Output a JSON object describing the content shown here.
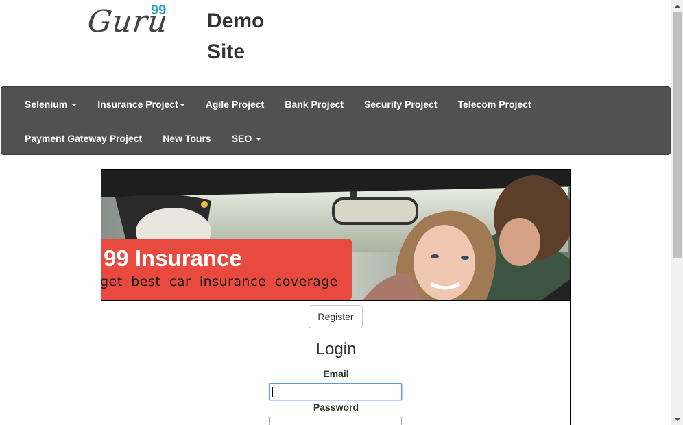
{
  "header": {
    "logo_text": "Guru",
    "logo_sup": "99",
    "site_title": "Demo Site"
  },
  "navbar": {
    "row1": [
      {
        "label": "Selenium",
        "dropdown": true
      },
      {
        "label": "Insurance Project",
        "dropdown": true
      },
      {
        "label": "Agile Project",
        "dropdown": false
      },
      {
        "label": "Bank Project",
        "dropdown": false
      },
      {
        "label": "Security Project",
        "dropdown": false
      },
      {
        "label": "Telecom Project",
        "dropdown": false
      }
    ],
    "row2": [
      {
        "label": "Payment Gateway Project",
        "dropdown": false
      },
      {
        "label": "New Tours",
        "dropdown": false
      },
      {
        "label": "SEO",
        "dropdown": true
      }
    ]
  },
  "banner": {
    "title": "99 Insurance",
    "subtitle": "get best car insurance coverage"
  },
  "form": {
    "register_label": "Register",
    "login_title": "Login",
    "email_label": "Email",
    "email_value": "",
    "password_label": "Password",
    "password_value": ""
  },
  "colors": {
    "navbar_bg": "#515151",
    "ribbon": "#e84a40",
    "logo_accent": "#37a3b6"
  }
}
